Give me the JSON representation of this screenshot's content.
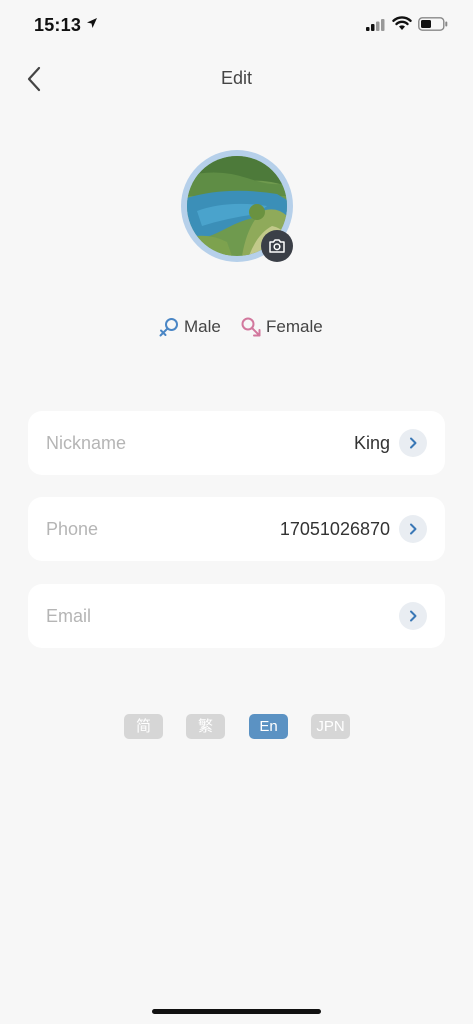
{
  "status_bar": {
    "time": "15:13"
  },
  "nav": {
    "title": "Edit"
  },
  "gender": {
    "male_label": "Male",
    "female_label": "Female"
  },
  "fields": {
    "nickname": {
      "label": "Nickname",
      "value": "King"
    },
    "phone": {
      "label": "Phone",
      "value": "17051026870"
    },
    "email": {
      "label": "Email",
      "value": ""
    }
  },
  "languages": [
    {
      "label": "简",
      "selected": false
    },
    {
      "label": "繁",
      "selected": false
    },
    {
      "label": "En",
      "selected": true
    },
    {
      "label": "JPN",
      "selected": false
    }
  ],
  "colors": {
    "accent": "#5b92c3",
    "male": "#4a86c5",
    "female": "#d2779d",
    "background": "#f7f7f7"
  },
  "icons": {
    "back": "chevron-left-icon",
    "camera": "camera-icon",
    "chevron": "chevron-right-icon",
    "male": "male-symbol-icon",
    "female": "female-symbol-icon"
  }
}
